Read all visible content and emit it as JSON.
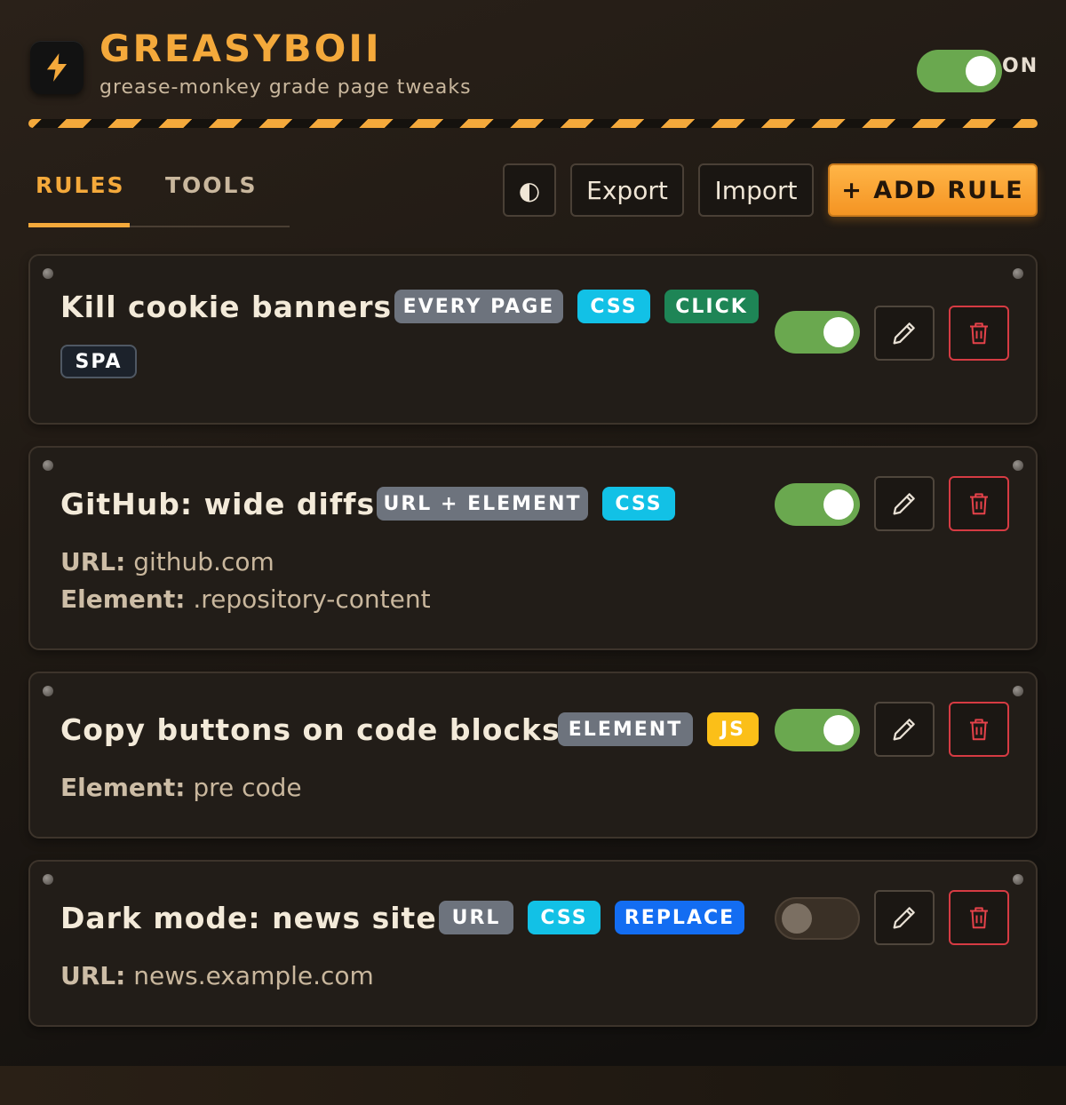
{
  "header": {
    "title": "GREASYBOII",
    "subtitle": "grease-monkey grade page tweaks",
    "master_state_label": "ON",
    "master_enabled": true,
    "logo_icon": "lightning-bolt-icon"
  },
  "colors": {
    "accent": "#f4a93b",
    "toggle_on": "#6aa84f",
    "danger": "#d63b43"
  },
  "tabs": [
    {
      "label": "RULES",
      "active": true
    },
    {
      "label": "TOOLS",
      "active": false
    }
  ],
  "toolbar": {
    "theme_icon": "◐",
    "export_label": "Export",
    "import_label": "Import",
    "add_label": "+ ADD RULE"
  },
  "rules": [
    {
      "name": "Kill cookie banners",
      "tags": [
        "EVERY PAGE",
        "CSS",
        "CLICK",
        "SPA"
      ],
      "enabled": true,
      "details": []
    },
    {
      "name": "GitHub: wide diffs",
      "tags": [
        "URL + ELEMENT",
        "CSS"
      ],
      "enabled": true,
      "details": [
        {
          "label": "URL:",
          "value": "github.com"
        },
        {
          "label": "Element:",
          "value": ".repository-content"
        }
      ]
    },
    {
      "name": "Copy buttons on code blocks",
      "tags": [
        "ELEMENT",
        "JS"
      ],
      "enabled": true,
      "details": [
        {
          "label": "Element:",
          "value": "pre code"
        }
      ]
    },
    {
      "name": "Dark mode: news site",
      "tags": [
        "URL",
        "CSS",
        "REPLACE"
      ],
      "enabled": false,
      "details": [
        {
          "label": "URL:",
          "value": "news.example.com"
        }
      ]
    }
  ]
}
